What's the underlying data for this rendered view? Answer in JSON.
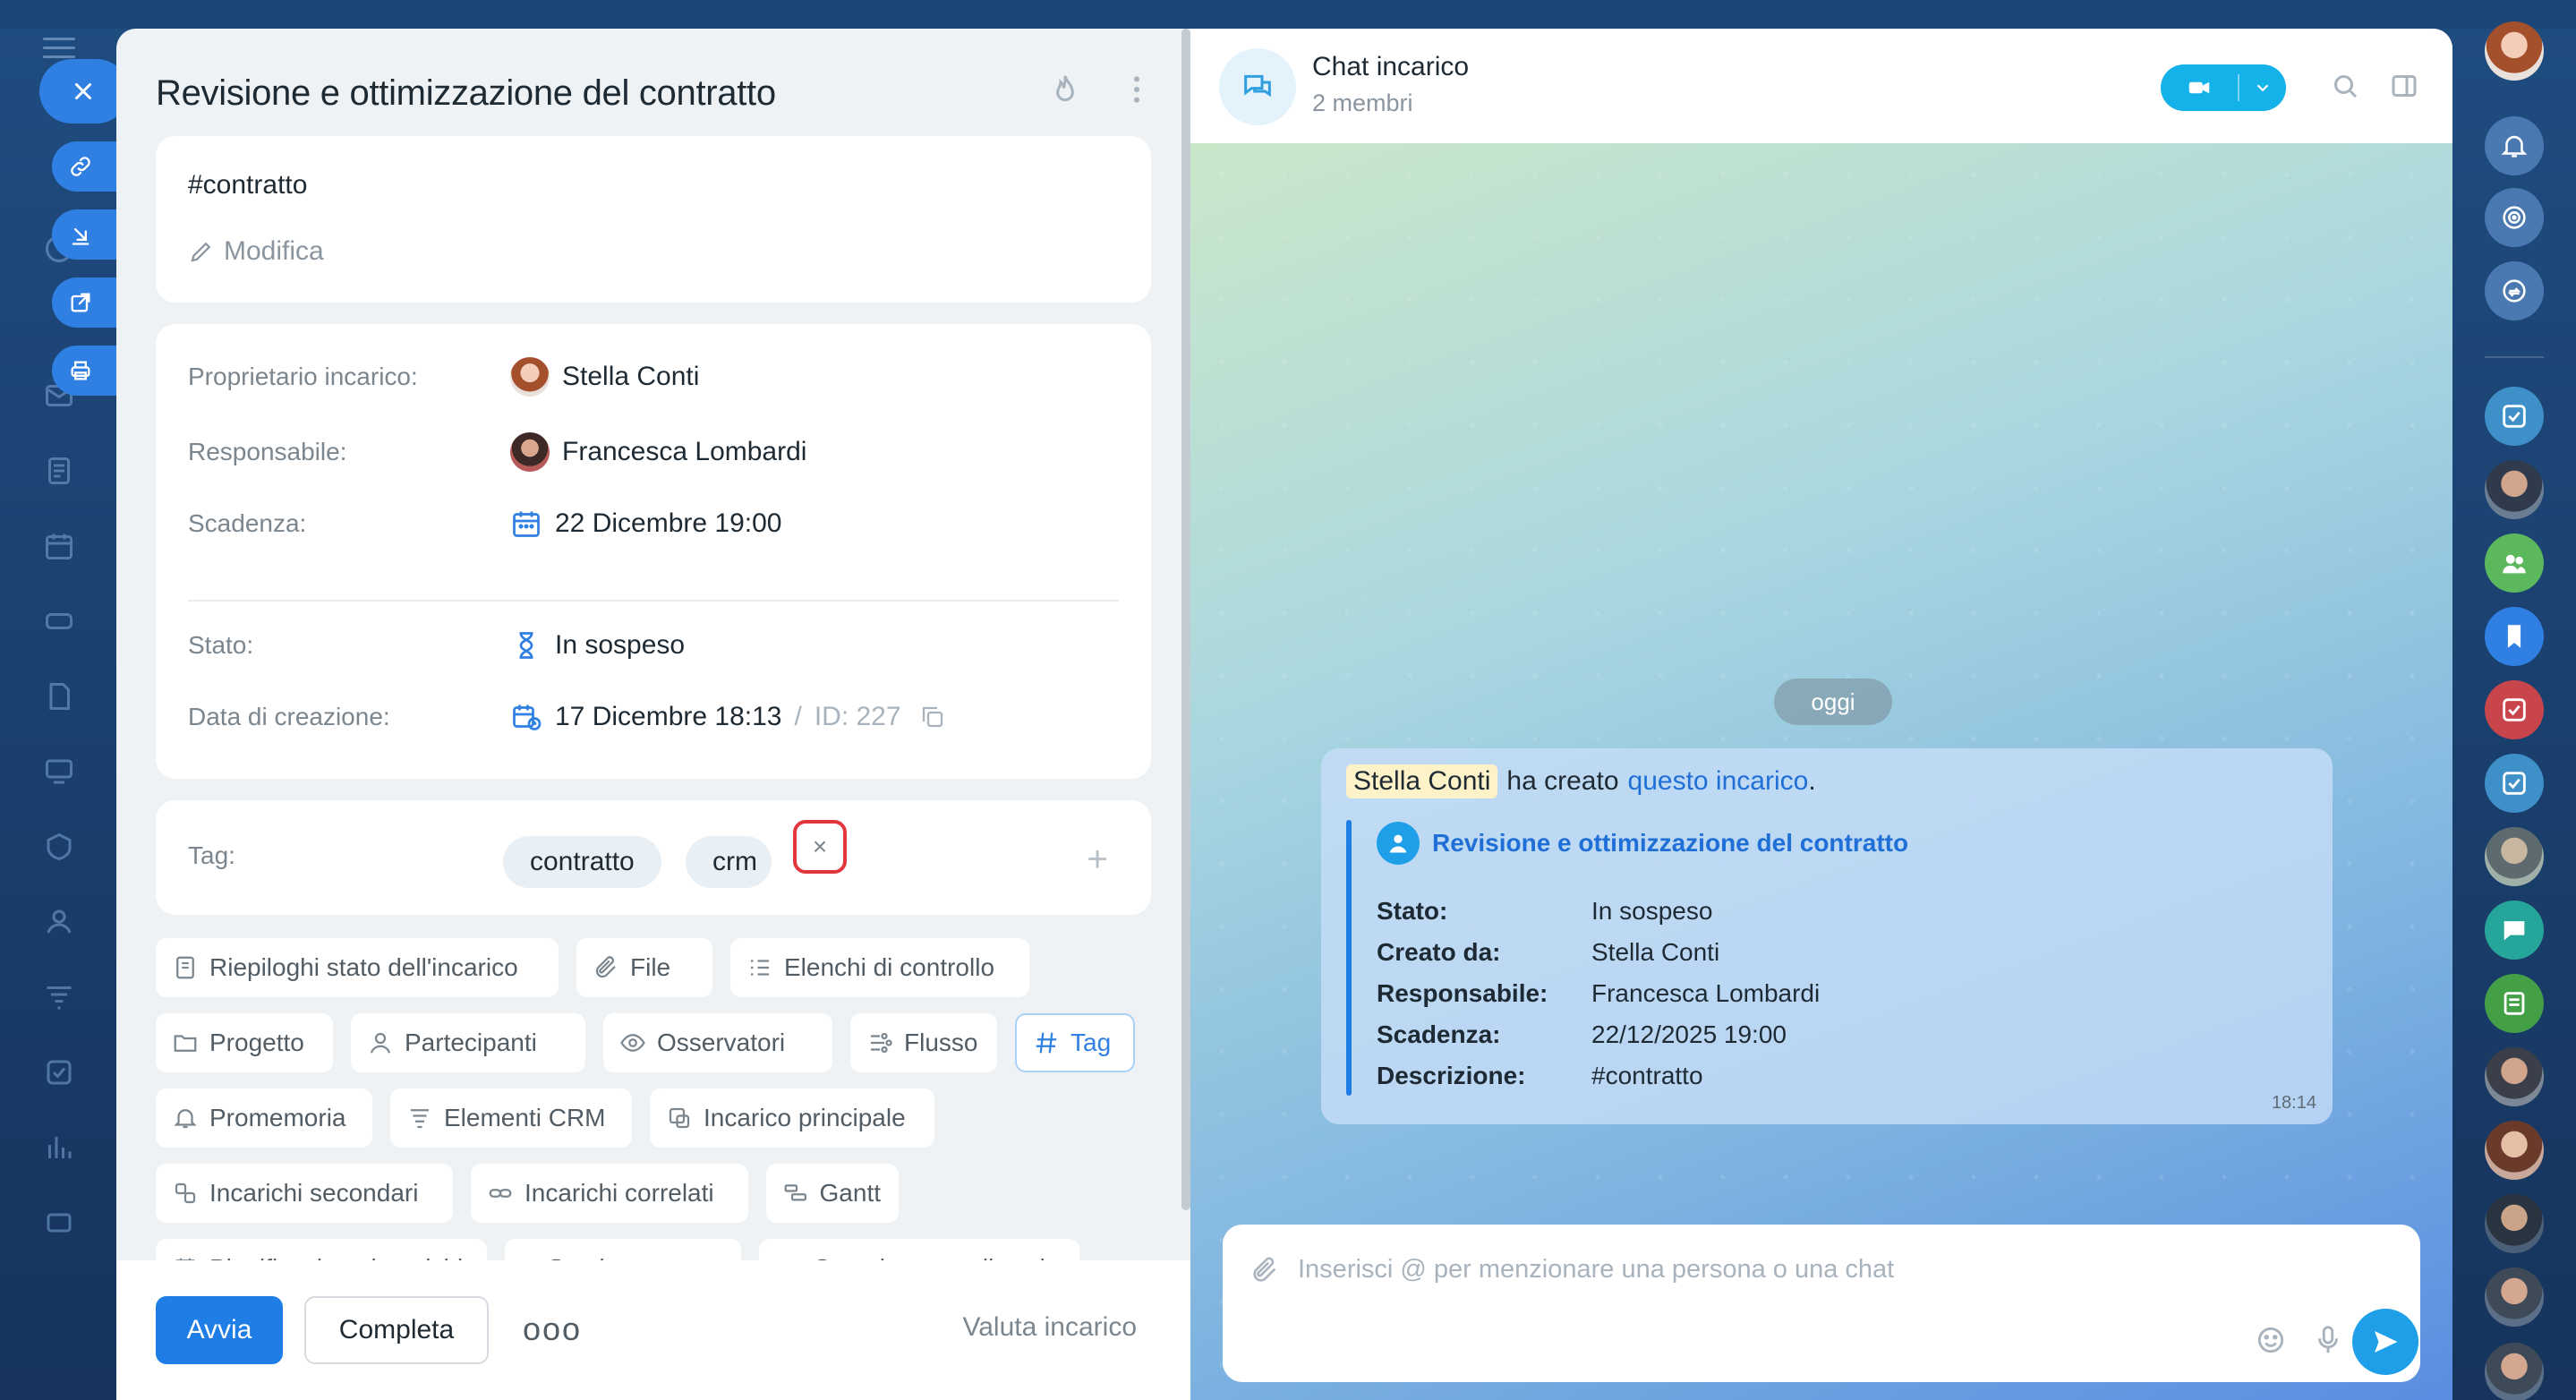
{
  "task": {
    "title": "Revisione e ottimizzazione del contratto",
    "description": "#contratto",
    "edit_label": "Modifica",
    "owner_label": "Proprietario incarico:",
    "owner": "Stella Conti",
    "responsible_label": "Responsabile:",
    "responsible": "Francesca Lombardi",
    "deadline_label": "Scadenza:",
    "deadline": "22 Dicembre 19:00",
    "status_label": "Stato:",
    "status": "In sospeso",
    "created_label": "Data di creazione:",
    "created": "17 Dicembre 18:13",
    "id_sep": "/",
    "id_text": "ID: 227",
    "tags_label": "Tag:",
    "tags": [
      "contratto",
      "crm"
    ],
    "tag_remove": "×",
    "tag_add": "+"
  },
  "chips": [
    "Riepiloghi stato dell'incarico",
    "File",
    "Elenchi di controllo",
    "Progetto",
    "Partecipanti",
    "Osservatori",
    "Flusso",
    "Tag",
    "Promemoria",
    "Elementi CRM",
    "Incarico principale",
    "Incarichi secondari",
    "Incarichi correlati",
    "Gantt",
    "Pianificazione incarichi",
    "Gestione tempo",
    "Campi personalizzati"
  ],
  "footer": {
    "start": "Avvia",
    "complete": "Completa",
    "more": "ooo",
    "rate": "Valuta incarico"
  },
  "chat": {
    "title": "Chat incarico",
    "members": "2 membri",
    "date": "oggi",
    "message": {
      "author": "Stella Conti",
      "action": "ha creato",
      "link": "questo incarico",
      "link_suffix": ".",
      "quote_title": "Revisione e ottimizzazione del contratto",
      "fields": [
        {
          "label": "Stato:",
          "value": "In sospeso"
        },
        {
          "label": "Creato da:",
          "value": "Stella Conti"
        },
        {
          "label": "Responsabile:",
          "value": "Francesca Lombardi"
        },
        {
          "label": "Scadenza:",
          "value": "22/12/2025 19:00"
        },
        {
          "label": "Descrizione:",
          "value": "#contratto"
        }
      ],
      "time": "18:14"
    },
    "input_placeholder": "Inserisci @ per menzionare una persona o una chat"
  },
  "colors": {
    "accent": "#1f7ee6",
    "close_pill": "#2f80e2",
    "highlight_box": "#e2353d"
  },
  "icons": {
    "header": [
      "fire-icon",
      "more-vertical-icon"
    ],
    "right_bar": [
      "bell-icon",
      "target-icon",
      "sync-icon",
      "task-icon",
      "group-icon",
      "bookmark-icon",
      "chat-icon"
    ]
  }
}
